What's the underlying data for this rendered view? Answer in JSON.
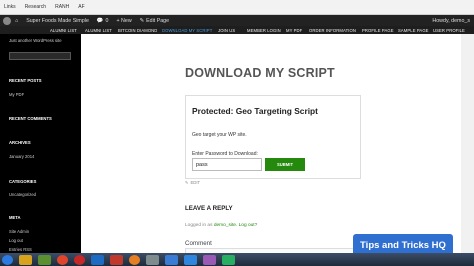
{
  "browser": {
    "bookmarks": [
      "Links",
      "Research",
      "RANH",
      "AF"
    ],
    "nav": "◂ ▸ ↻"
  },
  "adminbar": {
    "site_name": "Super Foods Made Simple",
    "comments_count": "0",
    "new_label": "+ New",
    "edit_label": "Edit Page",
    "howdy": "Howdy, demo_s"
  },
  "menu": {
    "items": [
      "ALUMNI LIST",
      "ALUMNI LIST",
      "BITCOIN DIAMOND",
      "DOWNLOAD MY SCRIPT",
      "JOIN US",
      "MEMBER LOGIN",
      "MY PDF",
      "ORDER INFORMATION",
      "PROFILE PAGE",
      "SAMPLE PAGE",
      "USER PROFILE"
    ],
    "active_index": 3
  },
  "sidebar": {
    "tagline": "Just another WordPress site",
    "recent_posts_header": "RECENT POSTS",
    "recent_post": "My PDF",
    "recent_comments_header": "RECENT COMMENTS",
    "archives_header": "ARCHIVES",
    "archive_item": "January 2014",
    "categories_header": "CATEGORIES",
    "category_item": "Uncategorized",
    "meta_header": "META",
    "meta_items": [
      "Site Admin",
      "Log out",
      "Entries RSS"
    ]
  },
  "content": {
    "title": "DOWNLOAD MY SCRIPT",
    "box_title": "Protected: Geo Targeting Script",
    "box_text": "Geo target your WP site.",
    "password_label": "Enter Password to Download:",
    "password_value": "pass",
    "submit_label": "SUBMIT",
    "edit_label": "EDIT",
    "leave_reply": "LEAVE A REPLY",
    "logged_in_prefix": "Logged in as",
    "logged_in_user": "demo_site",
    "logged_in_suffix": ". Log out?",
    "comment_label": "Comment"
  },
  "watermark": "Tips and Tricks HQ",
  "colors": {
    "accent": "#24890d",
    "menu_active": "#4a9ee0",
    "admin_bar": "#222222",
    "watermark": "#2f6fcf"
  }
}
